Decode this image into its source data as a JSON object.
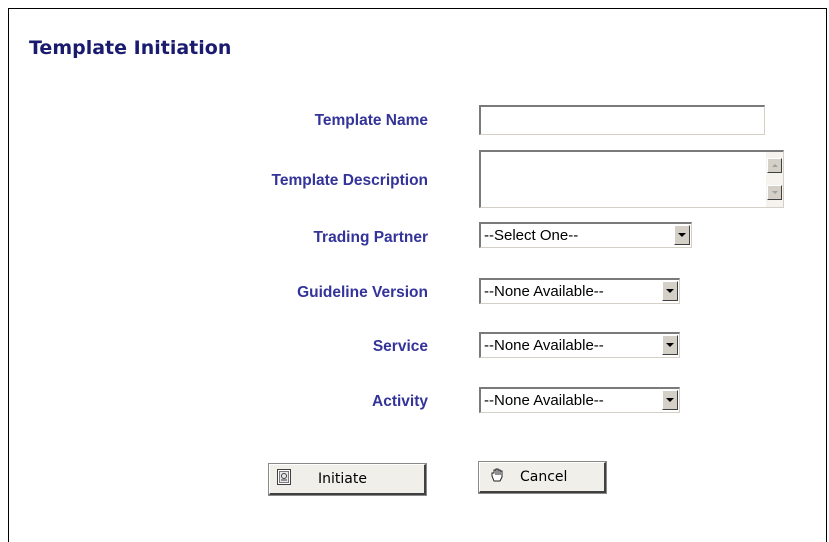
{
  "page": {
    "title": "Template Initiation"
  },
  "form": {
    "template_name": {
      "label": "Template Name",
      "value": ""
    },
    "template_description": {
      "label": "Template Description",
      "value": ""
    },
    "trading_partner": {
      "label": "Trading Partner",
      "selected": "--Select One--"
    },
    "guideline_version": {
      "label": "Guideline Version",
      "selected": "--None Available--"
    },
    "service": {
      "label": "Service",
      "selected": "--None Available--"
    },
    "activity": {
      "label": "Activity",
      "selected": "--None Available--"
    }
  },
  "buttons": {
    "initiate": {
      "label": "Initiate",
      "icon": "document-icon"
    },
    "cancel": {
      "label": "Cancel",
      "icon": "hand-icon"
    }
  },
  "colors": {
    "title": "#1a1a6e",
    "label": "#333399",
    "button_face": "#f0efe9"
  }
}
